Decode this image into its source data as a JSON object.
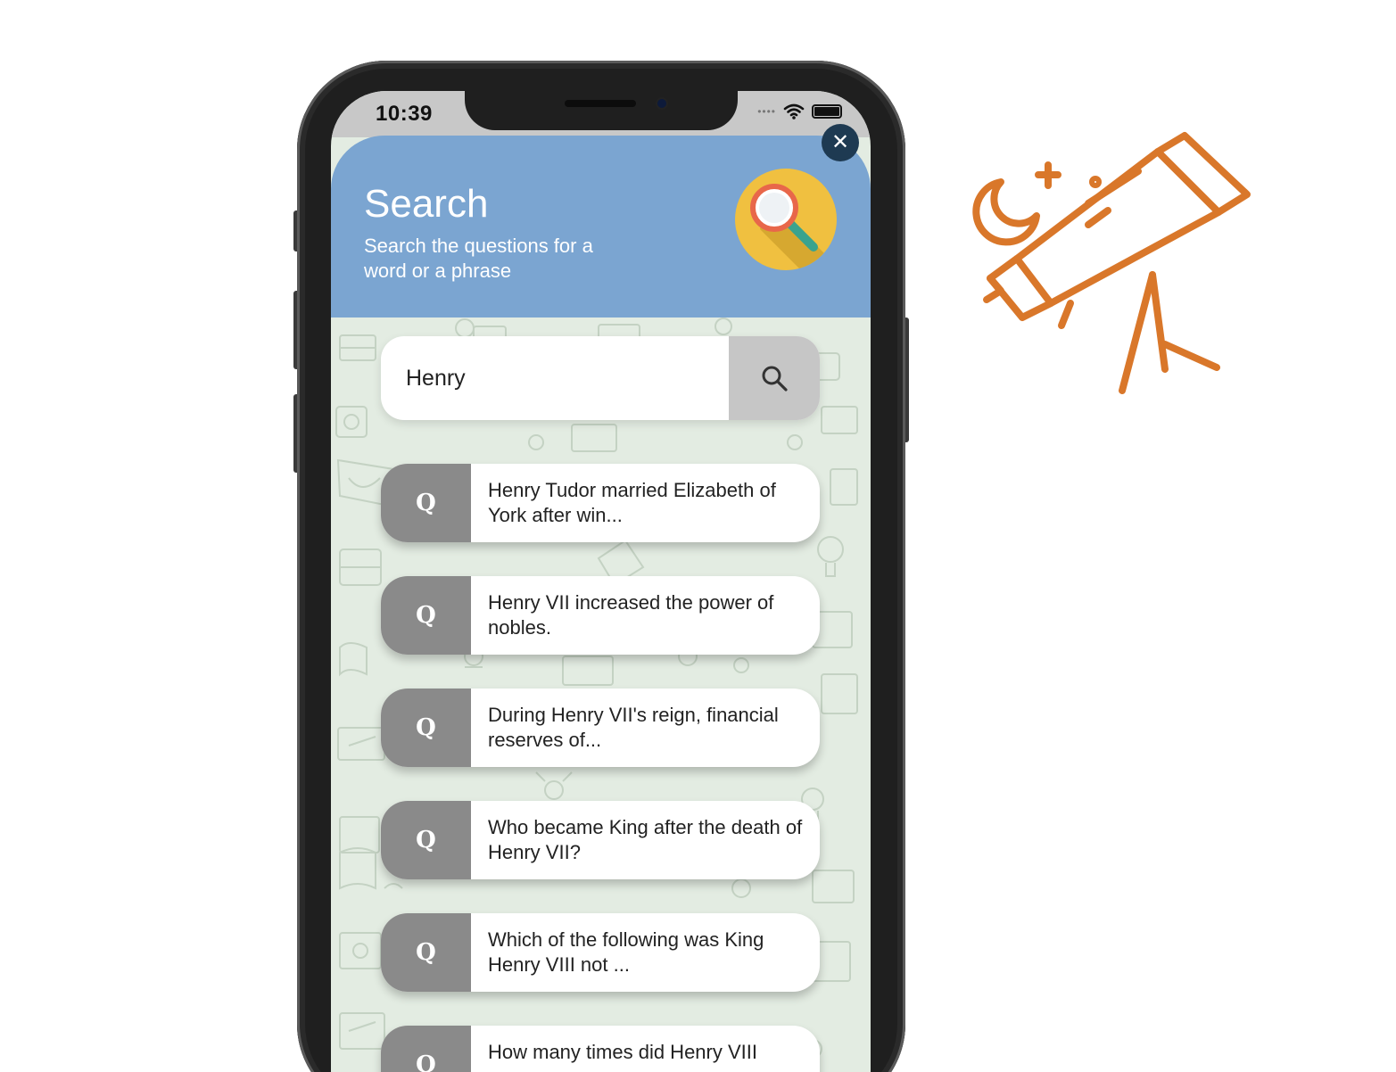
{
  "status_bar": {
    "time": "10:39"
  },
  "modal": {
    "title": "Search",
    "subtitle": "Search the questions for a word or a phrase",
    "close_label": "✕"
  },
  "search": {
    "value": "Henry"
  },
  "results": [
    {
      "badge": "Q",
      "text": "Henry Tudor married Elizabeth of York after win..."
    },
    {
      "badge": "Q",
      "text": "Henry VII increased the power of nobles."
    },
    {
      "badge": "Q",
      "text": "During Henry VII's reign, financial reserves of..."
    },
    {
      "badge": "Q",
      "text": "Who became King after the death of Henry VII?"
    },
    {
      "badge": "Q",
      "text": "Which of the following was King Henry VIII not ..."
    },
    {
      "badge": "Q",
      "text": "How many times did Henry VIII"
    }
  ],
  "colors": {
    "header": "#7ba5d1",
    "badge_yellow": "#f0c040",
    "result_badge": "#8a8a8a",
    "background": "#e3ece2",
    "telescope": "#d9772a"
  },
  "icons": {
    "close": "close-icon",
    "search": "search-icon",
    "badge": "magnifier-icon",
    "decoration": "telescope-icon"
  }
}
